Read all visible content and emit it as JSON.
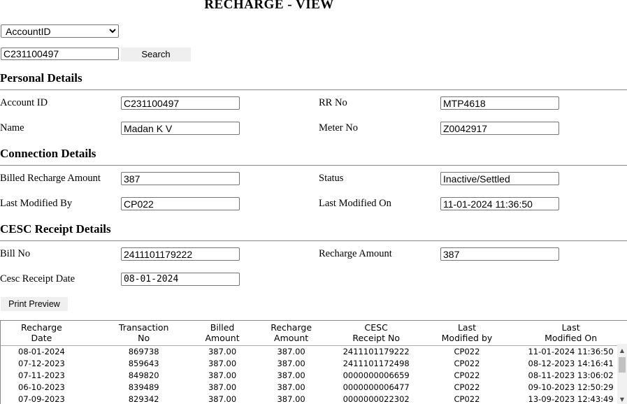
{
  "page": {
    "title": "RECHARGE - VIEW"
  },
  "search": {
    "field_selected": "AccountID",
    "value": "C231100497",
    "button_label": "Search"
  },
  "personal": {
    "heading": "Personal Details",
    "account_id_label": "Account ID",
    "account_id_value": "C231100497",
    "rr_no_label": "RR No",
    "rr_no_value": "MTP4618",
    "name_label": "Name",
    "name_value": "Madan K V",
    "meter_no_label": "Meter No",
    "meter_no_value": "Z0042917"
  },
  "connection": {
    "heading": "Connection Details",
    "billed_label": "Billed Recharge Amount",
    "billed_value": "387",
    "status_label": "Status",
    "status_value": "Inactive/Settled",
    "modified_by_label": "Last Modified By",
    "modified_by_value": "CP022",
    "modified_on_label": "Last Modified On",
    "modified_on_value": "11-01-2024 11:36:50"
  },
  "cesc": {
    "heading": "CESC Receipt Details",
    "bill_no_label": "Bill No",
    "bill_no_value": "2411101179222",
    "recharge_amount_label": "Recharge Amount",
    "recharge_amount_value": "387",
    "receipt_date_label": "Cesc Receipt Date",
    "receipt_date_value": "08-01-2024"
  },
  "print_button_label": "Print Preview",
  "table": {
    "columns": [
      "Recharge\nDate",
      "Transaction\nNo",
      "Billed\nAmount",
      "Recharge\nAmount",
      "CESC\nReceipt No",
      "Last\nModified by",
      "Last\nModified On"
    ],
    "rows": [
      [
        "08-01-2024",
        "869738",
        "387.00",
        "387.00",
        "2411101179222",
        "CP022",
        "11-01-2024 11:36:50"
      ],
      [
        "07-12-2023",
        "859643",
        "387.00",
        "387.00",
        "2411101172498",
        "CP022",
        "08-12-2023 14:16:41"
      ],
      [
        "07-11-2023",
        "849820",
        "387.00",
        "387.00",
        "0000000006659",
        "CP022",
        "08-11-2023 13:06:02"
      ],
      [
        "06-10-2023",
        "839489",
        "387.00",
        "387.00",
        "0000000006477",
        "CP022",
        "09-10-2023 12:50:29"
      ],
      [
        "07-09-2023",
        "829342",
        "387.00",
        "387.00",
        "0000000022302",
        "CP022",
        "13-09-2023 12:43:49"
      ]
    ]
  },
  "icons": {
    "scroll_up": "▲",
    "scroll_down": "▼"
  }
}
